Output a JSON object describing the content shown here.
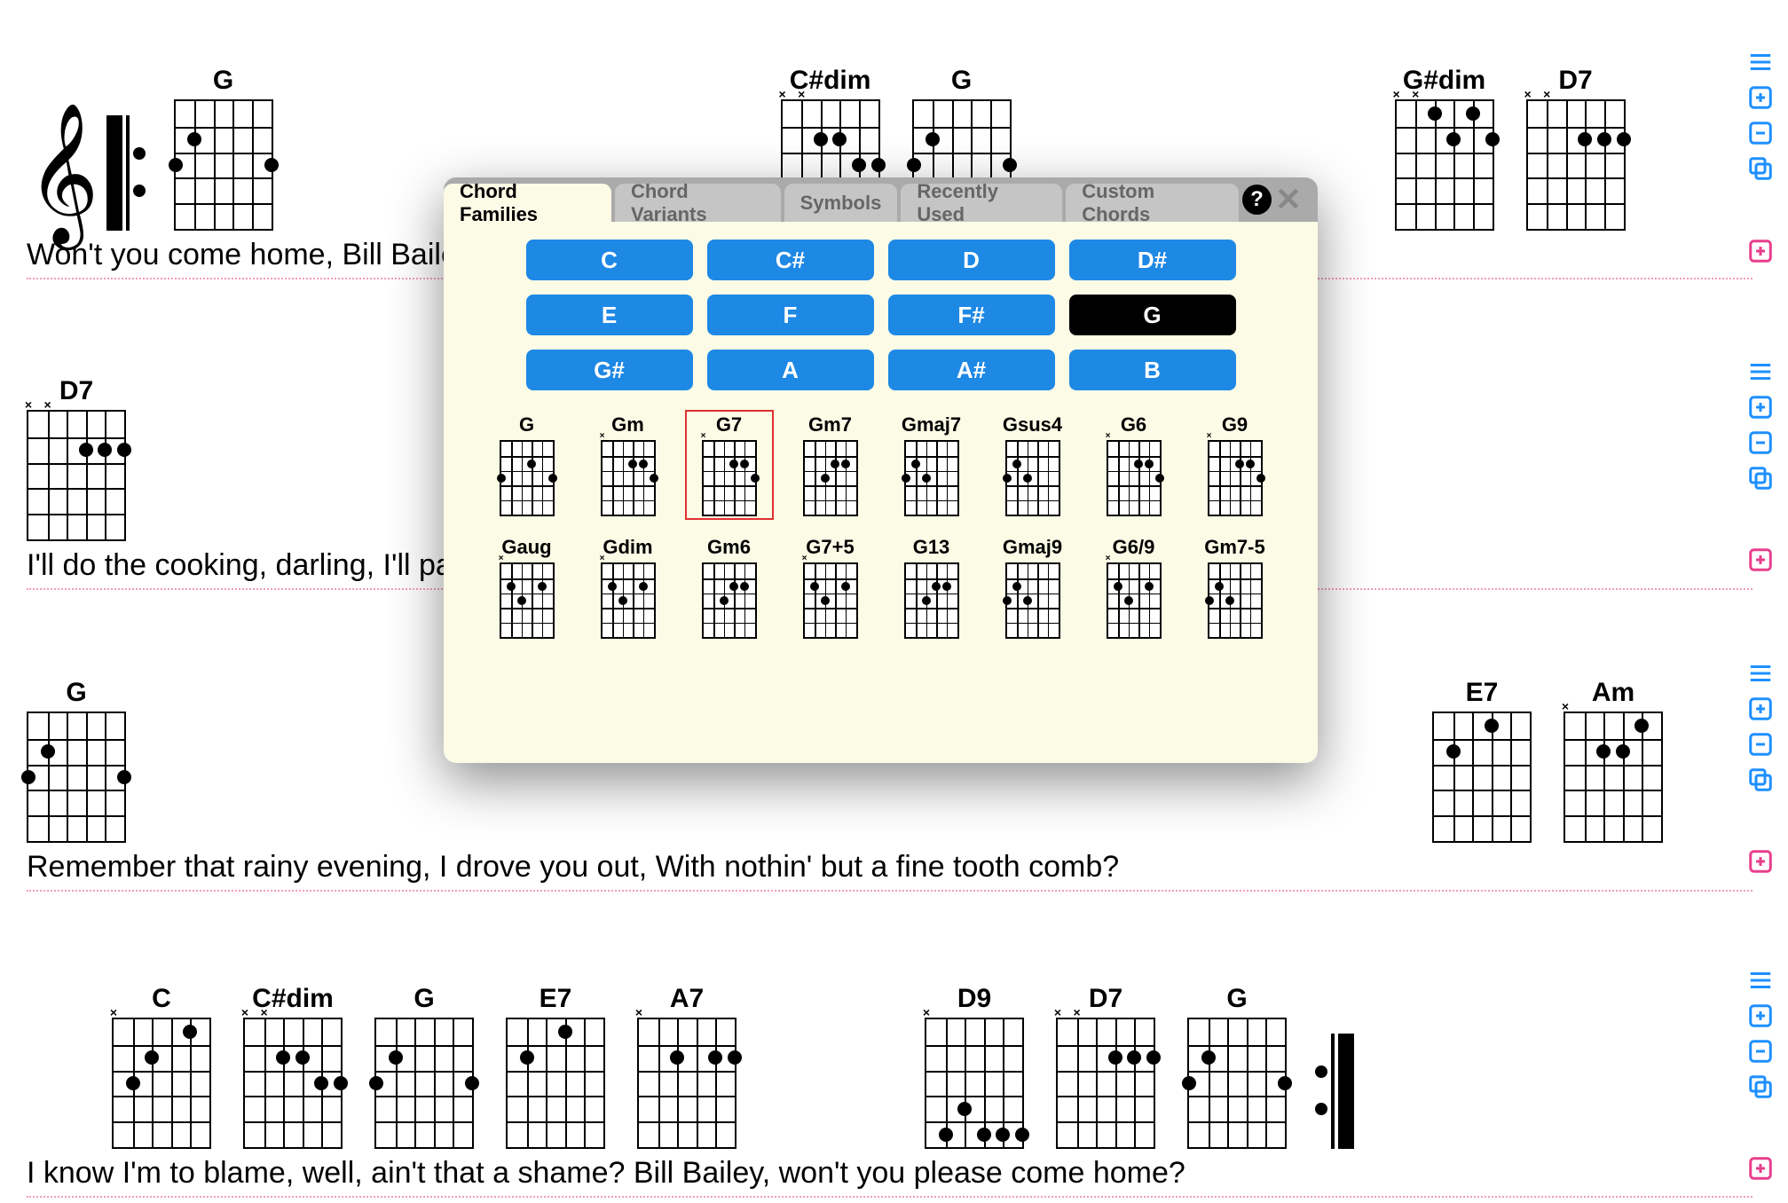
{
  "lines": [
    {
      "lyrics": "Won't you come home, Bill Bailey, won't you come home?   She moans the whole   day   long;",
      "chords": [
        "G",
        "C#dim",
        "G",
        "G#dim",
        "D7"
      ]
    },
    {
      "lyrics": "I'll do the cooking, darling, I'll pay the rent,    I know I've done     you    wrong;",
      "chords": [
        "D7"
      ]
    },
    {
      "lyrics": "Remember that rainy evening, I drove you out,    With nothin' but a   fine   tooth   comb?",
      "chords": [
        "G",
        "E7",
        "Am"
      ]
    },
    {
      "lyrics": "I know I'm to blame, well, ain't that a shame?  Bill Bailey, won't you   please   come   home?",
      "chords": [
        "C",
        "C#dim",
        "G",
        "E7",
        "A7",
        "D9",
        "D7",
        "G"
      ]
    }
  ],
  "modal": {
    "tabs": [
      "Chord Families",
      "Chord Variants",
      "Symbols",
      "Recently Used",
      "Custom Chords"
    ],
    "active_tab": 0,
    "roots": [
      "C",
      "C#",
      "D",
      "D#",
      "E",
      "F",
      "F#",
      "G",
      "G#",
      "A",
      "A#",
      "B"
    ],
    "selected_root": "G",
    "family": [
      "G",
      "Gm",
      "G7",
      "Gm7",
      "Gmaj7",
      "Gsus4",
      "G6",
      "G9",
      "Gaug",
      "Gdim",
      "Gm6",
      "G7+5",
      "G13",
      "Gmaj9",
      "G6/9",
      "Gm7-5"
    ],
    "highlighted": "G7"
  },
  "controls": {
    "drag_label": "drag-handle",
    "plus_label": "add-line",
    "minus_label": "remove-line",
    "copy_label": "duplicate-line",
    "add_pink_label": "add-section"
  }
}
